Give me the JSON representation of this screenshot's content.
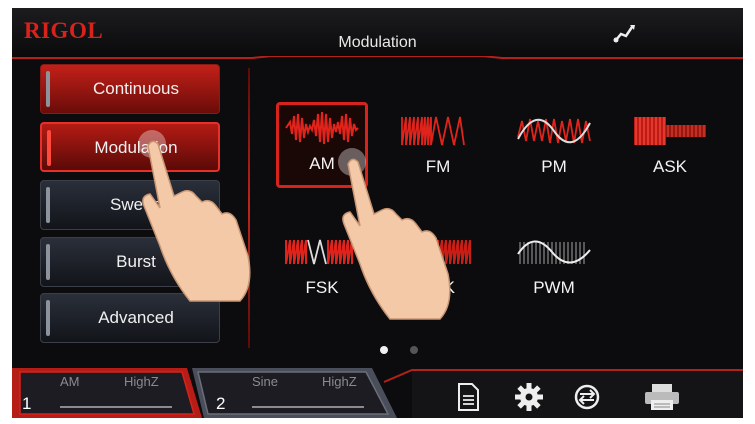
{
  "header": {
    "brand": "RIGOL",
    "title": "Modulation",
    "status_icon": "usb-icon"
  },
  "menu": {
    "items": [
      {
        "label": "Continuous",
        "state": "normal"
      },
      {
        "label": "Modulation",
        "state": "selected"
      },
      {
        "label": "Sweep",
        "state": "normal"
      },
      {
        "label": "Burst",
        "state": "normal"
      },
      {
        "label": "Advanced",
        "state": "normal"
      }
    ]
  },
  "modulation_types": [
    {
      "label": "AM",
      "selected": true
    },
    {
      "label": "FM"
    },
    {
      "label": "PM"
    },
    {
      "label": "ASK"
    },
    {
      "label": "FSK"
    },
    {
      "label": "PSK"
    },
    {
      "label": "PWM"
    }
  ],
  "pagination": {
    "current": 1,
    "total": 2
  },
  "channels": [
    {
      "number": "1",
      "waveform": "AM",
      "load": "HighZ"
    },
    {
      "number": "2",
      "waveform": "Sine",
      "load": "HighZ"
    }
  ],
  "toolbar": [
    "file-icon",
    "settings-gear-icon",
    "sync-icon",
    "printer-icon"
  ],
  "colors": {
    "accent": "#d8231c",
    "background": "#0c0c0e",
    "text": "#f0f0f0"
  }
}
